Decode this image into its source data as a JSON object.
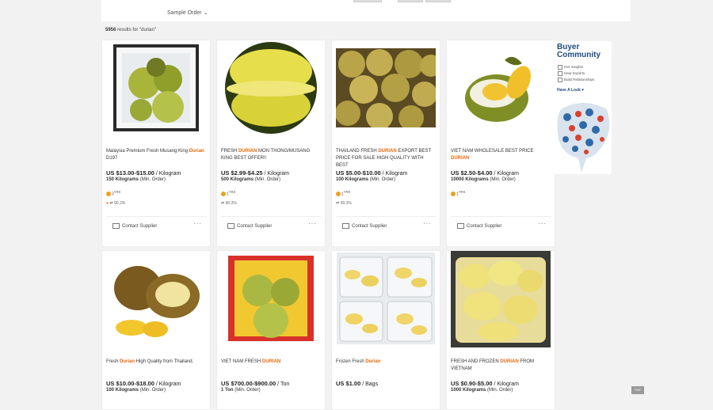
{
  "sort": {
    "label": "Sample Order"
  },
  "results": {
    "count": "5956",
    "text": " results for \"durian\""
  },
  "sidebar": {
    "title_1": "Buyer",
    "title_2": "Community",
    "items": [
      "Get Insights",
      "Hear Experts",
      "Build Relationships"
    ],
    "link": "Have A Look"
  },
  "products": [
    {
      "title_pre": "Malaysia Premium Fresh Musang King ",
      "title_hl": "Durian",
      "title_post": " D197",
      "price": "US $13.00-$15.00",
      "unit": " / Kilogram",
      "moq": "150 Kilograms",
      "moq_suffix": " (Min. Order)",
      "years": "3",
      "years_suffix": "YRS",
      "rating": "90.2%",
      "contact": "Contact Supplier"
    },
    {
      "title_pre": "FRESH ",
      "title_hl": "DURIAN",
      "title_post": " MON THONG/MUSANG KING BEST OFFER!!",
      "price": "US $2.99-$4.25",
      "unit": " / Kilogram",
      "moq": "500 Kilograms",
      "moq_suffix": " (Min. Order)",
      "years": "1",
      "years_suffix": "YRS",
      "rating": "90.3%",
      "contact": "Contact Supplier"
    },
    {
      "title_pre": "THAILAND FRESH ",
      "title_hl": "DURIAN",
      "title_post": " EXPORT BEST PRICE FOR SALE HIGH QUALITY WITH BEST",
      "price": "US $5.00-$10.00",
      "unit": " / Kilogram",
      "moq": "100 Kilograms",
      "moq_suffix": " (Min. Order)",
      "years": "1",
      "years_suffix": "YRS",
      "rating": "99.3%",
      "contact": "Contact Supplier"
    },
    {
      "title_pre": "VIET NAM WHOLESALE BEST PRICE ",
      "title_hl": "DURIAN",
      "title_post": "",
      "price": "US $2.50-$4.00",
      "unit": " / Kilogram",
      "moq": "10000 Kilograms",
      "moq_suffix": " (Min. Order)",
      "years": "1",
      "years_suffix": "YRS",
      "rating": "",
      "contact": "Contact Supplier"
    },
    {
      "title_pre": "Fresh ",
      "title_hl": "Durian",
      "title_post": " High Quality from Thailand.",
      "price": "US $10.00-$18.00",
      "unit": " / Kilogram",
      "moq": "100 Kilograms",
      "moq_suffix": " (Min. Order)"
    },
    {
      "title_pre": "VIET NAM FRESH ",
      "title_hl": "DURIAN",
      "title_post": "",
      "price": "US $700.00-$900.00",
      "unit": " / Ton",
      "moq": "1 Ton",
      "moq_suffix": " (Min. Order)"
    },
    {
      "title_pre": "Frozen Fresh ",
      "title_hl": "Durian",
      "title_post": "",
      "price": "US $1.00",
      "unit": " / Bags",
      "moq": "",
      "moq_suffix": ""
    },
    {
      "title_pre": "FRESH AND FROZEN ",
      "title_hl": "DURIAN",
      "title_post": " FROM VIETNAM",
      "price": "US $0.90-$5.00",
      "unit": " / Kilogram",
      "moq": "1000 Kilograms",
      "moq_suffix": " (Min. Order)"
    }
  ],
  "fab": {
    "label": "TOP"
  }
}
